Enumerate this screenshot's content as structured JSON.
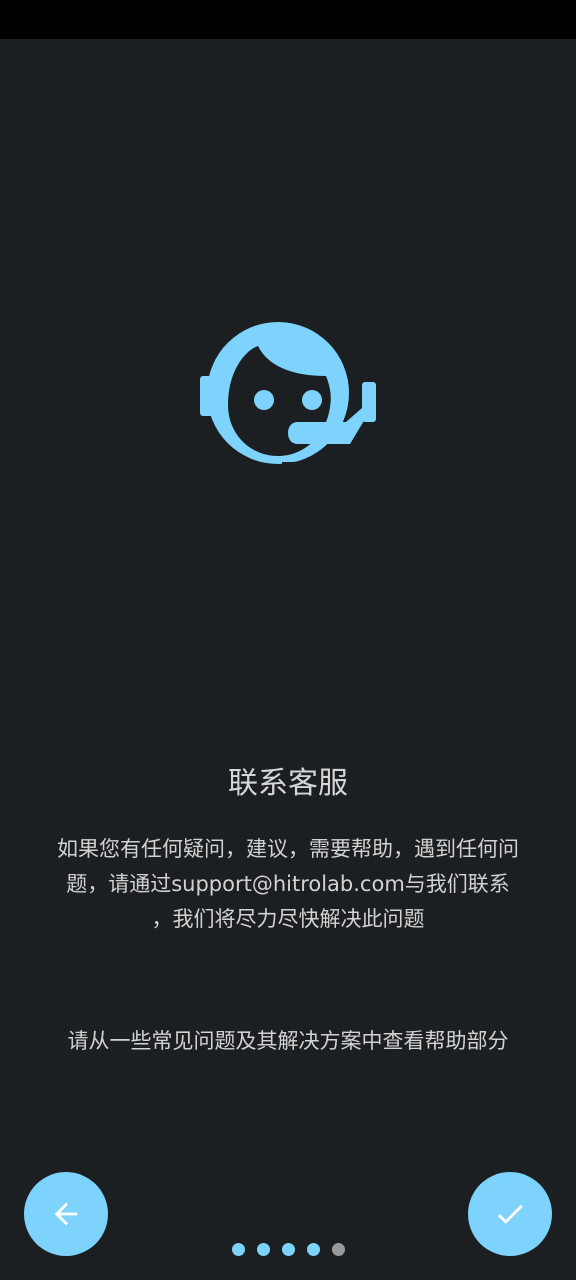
{
  "screen": {
    "title": "联系客服",
    "description_line1": "如果您有任何疑问，建议，需要帮助，遇到任何问",
    "description_line2": "题，请通过support@hitrolab.com与我们联系",
    "description_line3": "，我们将尽力尽快解决此问题",
    "hint": "请从一些常见问题及其解决方案中查看帮助部分"
  },
  "icons": {
    "hero": "support-agent-icon",
    "back": "arrow-left-icon",
    "done": "check-icon"
  },
  "pager": {
    "total": 5,
    "active_indices": [
      0,
      1,
      2,
      3
    ],
    "inactive_indices": [
      4
    ]
  },
  "colors": {
    "background": "#1b1f22",
    "accent": "#7dd3fb",
    "text": "#d2d2d2",
    "dot_inactive": "#9a9a9a",
    "status_bar": "#000000"
  }
}
